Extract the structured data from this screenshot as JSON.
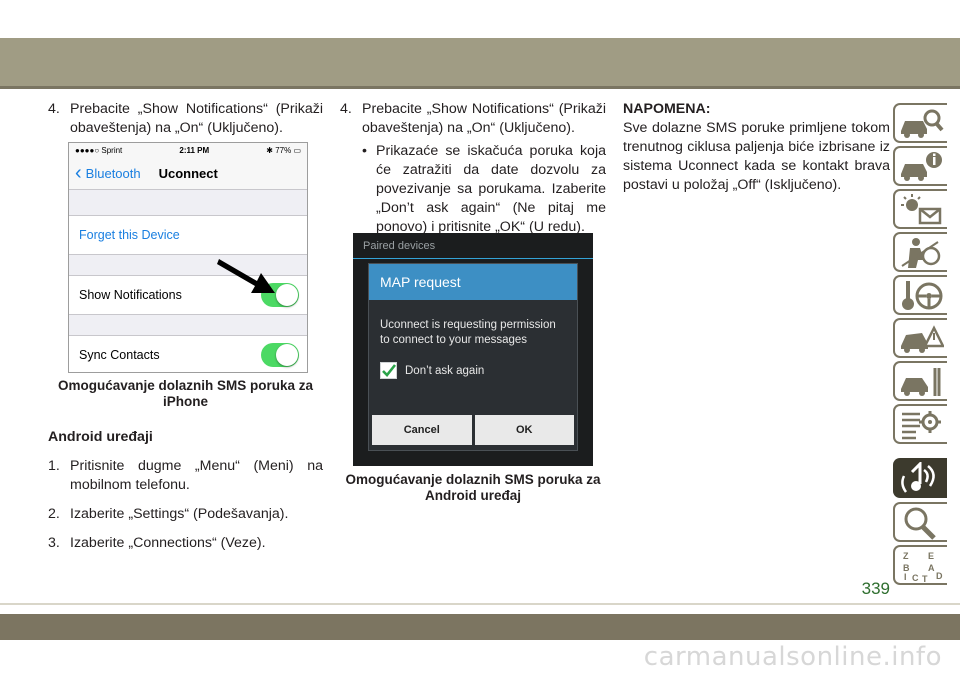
{
  "page_number": "339",
  "watermark": "carmanualsonline.info",
  "col1": {
    "step4_num": "4.",
    "step4_text": "Prebacite „Show Notifications“ (Prikaži obaveštenja) na „On“ (Uključeno).",
    "iphone": {
      "carrier": "●●●●○ Sprint",
      "time": "2:11 PM",
      "battery": "77%",
      "back_label": "Bluetooth",
      "title": "Uconnect",
      "forget_label": "Forget this Device",
      "show_notifications_label": "Show Notifications",
      "sync_contacts_label": "Sync Contacts"
    },
    "caption": "Omogućavanje dolaznih SMS poruka za iPhone",
    "heading": "Android uređaji",
    "steps": [
      {
        "num": "1.",
        "text": "Pritisnite dugme „Menu“ (Meni) na mobilnom telefonu."
      },
      {
        "num": "2.",
        "text": "Izaberite „Settings“ (Podešavanja)."
      },
      {
        "num": "3.",
        "text": "Izaberite „Connections“ (Veze)."
      }
    ]
  },
  "col2": {
    "step4_num": "4.",
    "step4_text": "Prebacite „Show Notifications“ (Prikaži obaveštenja) na „On“ (Uključeno).",
    "bullet": "•",
    "bullet_text": "Prikazaće se iskačuća poruka koja će zatražiti da date dozvolu za povezivanje sa porukama. Izaberite „Don’t ask again“ (Ne pitaj me ponovo) i pritisnite „OK“ (U redu).",
    "android": {
      "header": "Paired devices",
      "dialog_title": "MAP request",
      "dialog_message": "Uconnect is requesting permission to connect to your messages",
      "checkbox_label": "Don’t ask again",
      "cancel_label": "Cancel",
      "ok_label": "OK"
    },
    "caption": "Omogućavanje dolaznih SMS poruka za Android uređaj"
  },
  "col3": {
    "note_heading": "NAPOMENA:",
    "note_text": "Sve dolazne SMS poruke primljene tokom trenutnog ciklusa paljenja biće izbrisane iz sistema Uconnect kada se kontakt brava postavi u položaj „Off“ (Isključeno)."
  },
  "sidebar_tabs": [
    {
      "icon": "car-search-icon"
    },
    {
      "icon": "car-info-icon"
    },
    {
      "icon": "warning-lights-message-icon"
    },
    {
      "icon": "airbag-seat-icon"
    },
    {
      "icon": "key-steering-wheel-icon"
    },
    {
      "icon": "car-hazard-icon"
    },
    {
      "icon": "car-wrench-icon"
    },
    {
      "icon": "specifications-gear-icon"
    },
    {
      "icon": "multimedia-music-icon",
      "active": true
    },
    {
      "icon": "search-index-icon"
    },
    {
      "icon": "alphabet-index-icon",
      "letters": [
        "Z",
        "E",
        "B",
        "A",
        "C",
        "D",
        "I",
        "T"
      ]
    }
  ]
}
